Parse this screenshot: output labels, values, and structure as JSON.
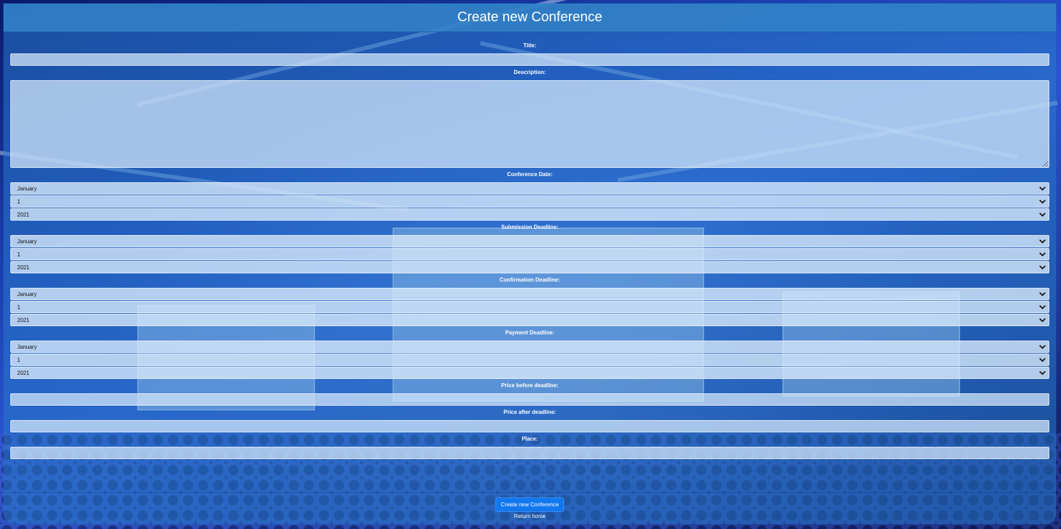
{
  "header": {
    "title": "Create new Conference"
  },
  "form": {
    "title_label": "Title:",
    "title_value": "",
    "description_label": "Description:",
    "description_value": "",
    "conference_date": {
      "label": "Conference Date:",
      "month": "January",
      "day": "1",
      "year": "2021"
    },
    "submission_deadline": {
      "label": "Submission Deadline:",
      "month": "January",
      "day": "1",
      "year": "2021"
    },
    "confirmation_deadline": {
      "label": "Confirmation Deadline:",
      "month": "January",
      "day": "1",
      "year": "2021"
    },
    "payment_deadline": {
      "label": "Payment Deadline:",
      "month": "January",
      "day": "1",
      "year": "2021"
    },
    "price_before_label": "Price before deadline:",
    "price_before_value": "",
    "price_after_label": "Price after deadline:",
    "price_after_value": "",
    "place_label": "Place:",
    "place_value": ""
  },
  "footer": {
    "submit_label": "Create new Conference",
    "return_label": "Return home"
  },
  "colors": {
    "panel_header": "#3282c8",
    "button": "#1177ee",
    "field_bg": "#d2e6fa"
  },
  "icons": {
    "select_arrow": "chevron-down-icon"
  }
}
